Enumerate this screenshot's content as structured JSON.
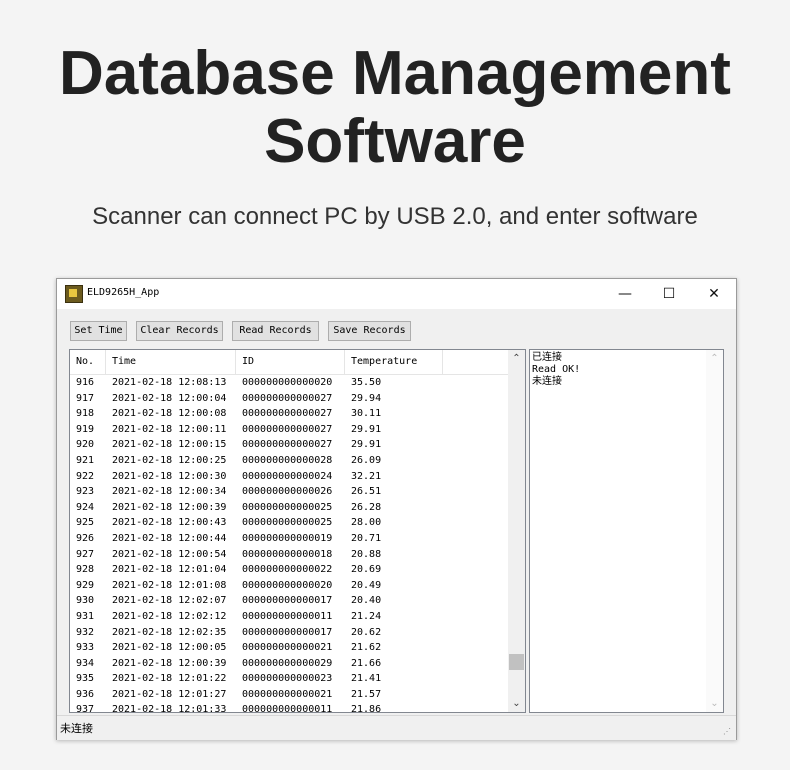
{
  "headline": {
    "line1": "Database Management",
    "line2": "Software"
  },
  "subtitle": "Scanner can connect PC by USB 2.0, and enter software",
  "window": {
    "title": "ELD9265H_App",
    "controls": {
      "minimize": "—",
      "maximize": "☐",
      "close": "✕"
    }
  },
  "toolbar": {
    "set_time": "Set Time",
    "clear_records": "Clear Records",
    "read_records": "Read Records",
    "save_records": "Save Records"
  },
  "table": {
    "columns": [
      "No.",
      "Time",
      "ID",
      "Temperature"
    ],
    "rows": [
      [
        "916",
        "2021-02-18 12:08:13",
        "000000000000020",
        "35.50"
      ],
      [
        "917",
        "2021-02-18 12:00:04",
        "000000000000027",
        "29.94"
      ],
      [
        "918",
        "2021-02-18 12:00:08",
        "000000000000027",
        "30.11"
      ],
      [
        "919",
        "2021-02-18 12:00:11",
        "000000000000027",
        "29.91"
      ],
      [
        "920",
        "2021-02-18 12:00:15",
        "000000000000027",
        "29.91"
      ],
      [
        "921",
        "2021-02-18 12:00:25",
        "000000000000028",
        "26.09"
      ],
      [
        "922",
        "2021-02-18 12:00:30",
        "000000000000024",
        "32.21"
      ],
      [
        "923",
        "2021-02-18 12:00:34",
        "000000000000026",
        "26.51"
      ],
      [
        "924",
        "2021-02-18 12:00:39",
        "000000000000025",
        "26.28"
      ],
      [
        "925",
        "2021-02-18 12:00:43",
        "000000000000025",
        "28.00"
      ],
      [
        "926",
        "2021-02-18 12:00:44",
        "000000000000019",
        "20.71"
      ],
      [
        "927",
        "2021-02-18 12:00:54",
        "000000000000018",
        "20.88"
      ],
      [
        "928",
        "2021-02-18 12:01:04",
        "000000000000022",
        "20.69"
      ],
      [
        "929",
        "2021-02-18 12:01:08",
        "000000000000020",
        "20.49"
      ],
      [
        "930",
        "2021-02-18 12:02:07",
        "000000000000017",
        "20.40"
      ],
      [
        "931",
        "2021-02-18 12:02:12",
        "000000000000011",
        "21.24"
      ],
      [
        "932",
        "2021-02-18 12:02:35",
        "000000000000017",
        "20.62"
      ],
      [
        "933",
        "2021-02-18 12:00:05",
        "000000000000021",
        "21.62"
      ],
      [
        "934",
        "2021-02-18 12:00:39",
        "000000000000029",
        "21.66"
      ],
      [
        "935",
        "2021-02-18 12:01:22",
        "000000000000023",
        "21.41"
      ],
      [
        "936",
        "2021-02-18 12:01:27",
        "000000000000021",
        "21.57"
      ],
      [
        "937",
        "2021-02-18 12:01:33",
        "000000000000011",
        "21.86"
      ]
    ]
  },
  "log": [
    "已连接",
    "Read OK!",
    "未连接"
  ],
  "statusbar": {
    "text": "未连接"
  },
  "icons": {
    "scroll_up": "⌃",
    "scroll_down": "⌄",
    "grip": "⋰"
  }
}
